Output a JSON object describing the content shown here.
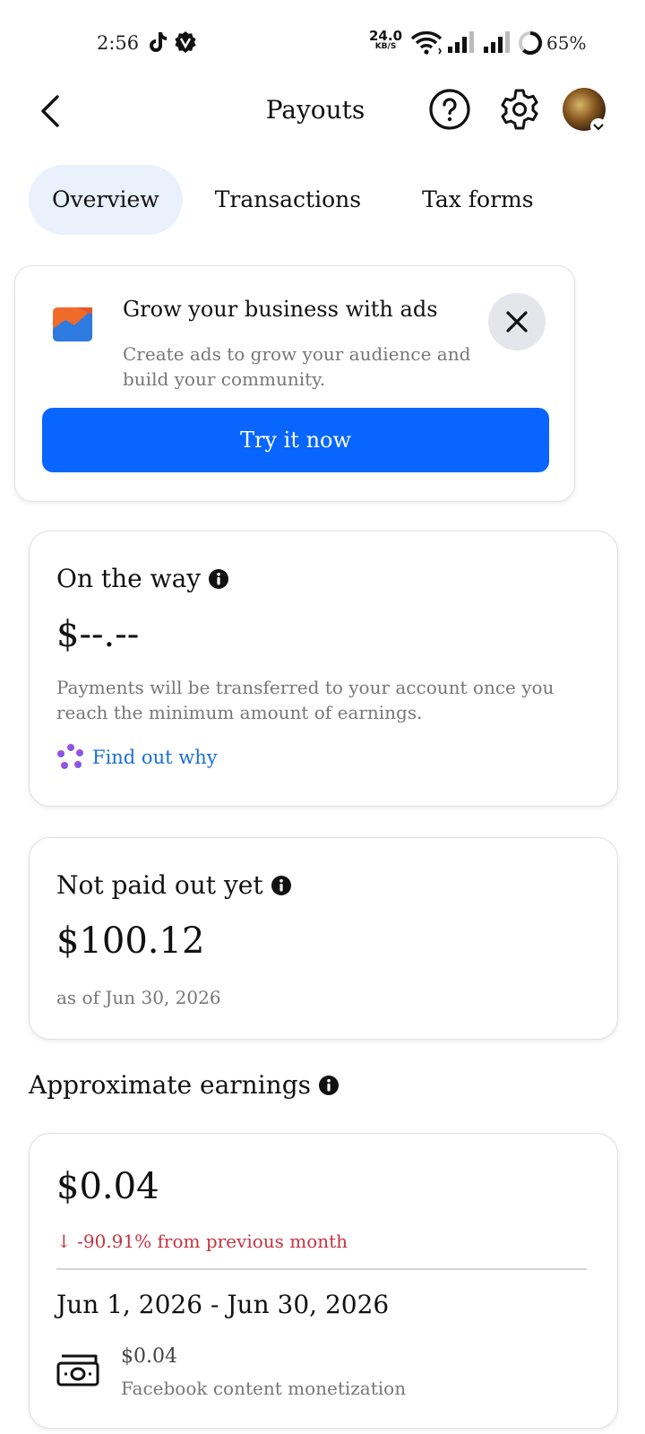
{
  "status_bar": {
    "time": "2:56",
    "net_speed_value": "24.0",
    "net_speed_unit": "KB/S",
    "battery": "65%"
  },
  "header": {
    "title": "Payouts"
  },
  "tabs": [
    {
      "label": "Overview",
      "active": true
    },
    {
      "label": "Transactions",
      "active": false
    },
    {
      "label": "Tax forms",
      "active": false
    }
  ],
  "ad_card": {
    "title": "Grow your business with ads",
    "description": "Create ads to grow your audience and build your community.",
    "cta": "Try it now"
  },
  "on_the_way": {
    "title": "On the way",
    "amount": "$--.--",
    "note": "Payments will be transferred to your account once you reach the minimum amount of earnings.",
    "link": "Find out why"
  },
  "not_paid": {
    "title": "Not paid out yet",
    "amount": "$100.12",
    "as_of": "as of Jun 30, 2026"
  },
  "earnings": {
    "section_title": "Approximate earnings",
    "amount": "$0.04",
    "delta": "↓ -90.91% from previous month",
    "range": "Jun 1, 2026 - Jun 30, 2026",
    "row_amount": "$0.04",
    "row_label": "Facebook content monetization"
  },
  "colors": {
    "accent": "#0866ff",
    "tab_active_bg": "#e8f1fc",
    "negative": "#c4343f",
    "link": "#1a6fd4"
  },
  "icons": [
    "tiktok-icon",
    "vpn-icon",
    "wifi-icon",
    "signal-icon",
    "battery-icon",
    "back-arrow-icon",
    "help-icon",
    "gear-icon",
    "chevron-down-icon",
    "ads-chart-icon",
    "close-icon",
    "info-icon",
    "ai-sparkle-icon",
    "cash-icon"
  ]
}
